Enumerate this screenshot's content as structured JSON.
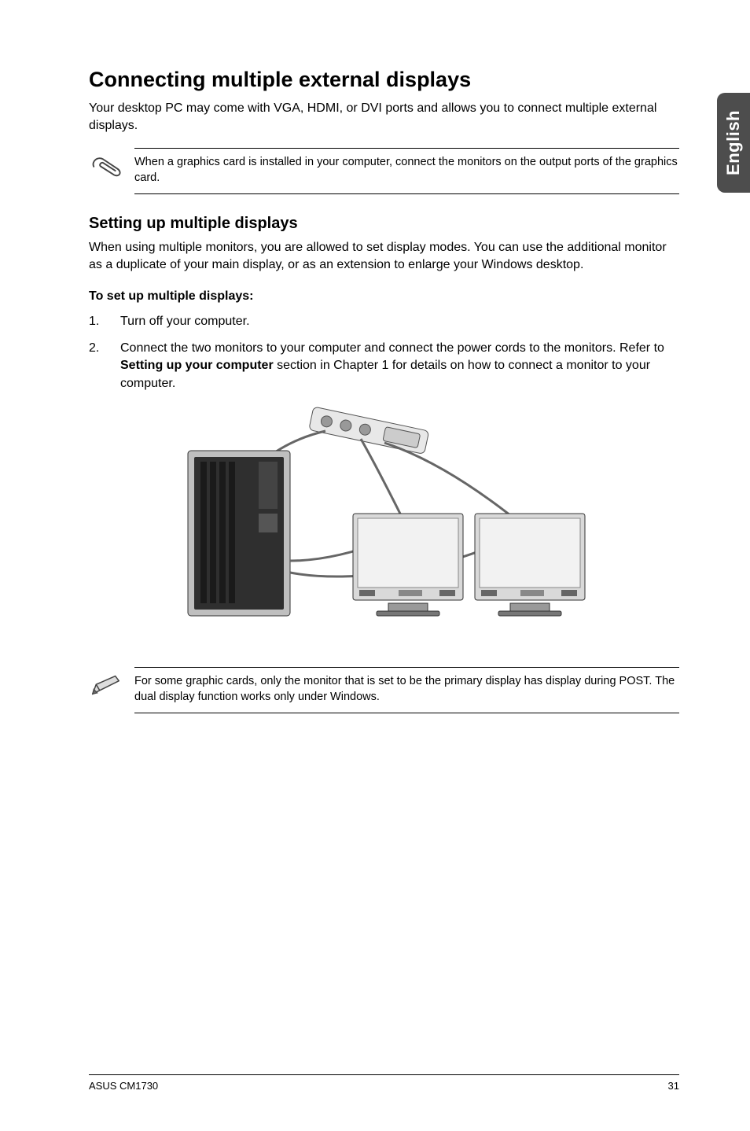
{
  "language_tab": "English",
  "title": "Connecting multiple external displays",
  "intro": "Your desktop PC may come with VGA, HDMI, or DVI ports and allows you to connect multiple external displays.",
  "note1": "When a graphics card is installed in your computer, connect the monitors on the output ports of the graphics card.",
  "section_heading": "Setting up multiple displays",
  "section_body": "When using multiple monitors, you are allowed to set display modes. You can use the additional monitor as a duplicate of your main display, or as an extension to enlarge your Windows desktop.",
  "steps_heading": "To set up multiple displays:",
  "steps": {
    "s1": "Turn off your computer.",
    "s2_pre": "Connect the two monitors to your computer and connect the power cords to the monitors. Refer to ",
    "s2_bold": "Setting up your computer",
    "s2_post": " section in Chapter 1 for details on how to connect a monitor to your computer."
  },
  "note2": "For some graphic cards, only the monitor that is set to be the primary display has display during POST. The dual display function works only under Windows.",
  "footer_left": "ASUS CM1730",
  "footer_right": "31"
}
